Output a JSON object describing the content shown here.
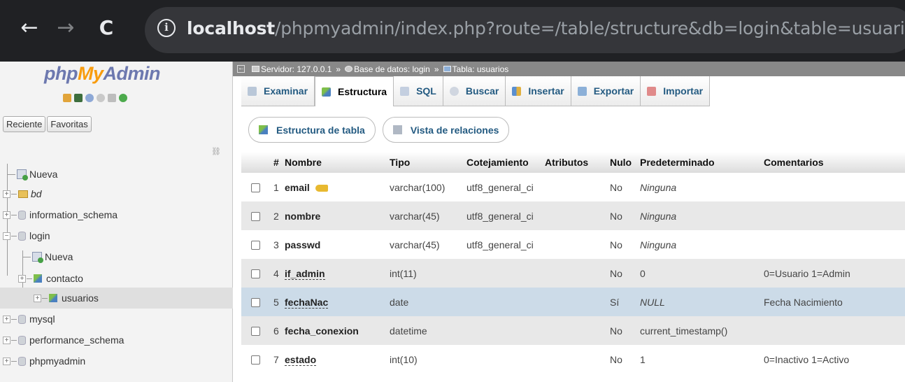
{
  "browser": {
    "url_host": "localhost",
    "url_path": "/phpmyadmin/index.php?route=/table/structure&db=login&table=usuarios"
  },
  "sidebar": {
    "logo": {
      "php": "php",
      "my": "My",
      "admin": "Admin"
    },
    "tabs": [
      "Reciente",
      "Favoritas"
    ],
    "tree": [
      {
        "label": "Nueva",
        "kind": "new"
      },
      {
        "label": "bd",
        "kind": "db-italic"
      },
      {
        "label": "information_schema",
        "kind": "db"
      },
      {
        "label": "login",
        "kind": "db-open"
      },
      {
        "label": "Nueva",
        "kind": "new-child"
      },
      {
        "label": "contacto",
        "kind": "table"
      },
      {
        "label": "usuarios",
        "kind": "table-selected"
      },
      {
        "label": "mysql",
        "kind": "db"
      },
      {
        "label": "performance_schema",
        "kind": "db"
      },
      {
        "label": "phpmyadmin",
        "kind": "db"
      }
    ]
  },
  "breadcrumb": {
    "server": "Servidor: 127.0.0.1",
    "database": "Base de datos: login",
    "table": "Tabla: usuarios",
    "separator": "»"
  },
  "tabs": [
    "Examinar",
    "Estructura",
    "SQL",
    "Buscar",
    "Insertar",
    "Exportar",
    "Importar"
  ],
  "active_tab": "Estructura",
  "subtabs": [
    "Estructura de tabla",
    "Vista de relaciones"
  ],
  "table": {
    "headers": [
      "#",
      "Nombre",
      "Tipo",
      "Cotejamiento",
      "Atributos",
      "Nulo",
      "Predeterminado",
      "Comentarios"
    ],
    "rows": [
      {
        "num": "1",
        "name": "email",
        "type": "varchar(100)",
        "collation": "utf8_general_ci",
        "attributes": "",
        "null": "No",
        "default": "Ninguna",
        "comment": ""
      },
      {
        "num": "2",
        "name": "nombre",
        "type": "varchar(45)",
        "collation": "utf8_general_ci",
        "attributes": "",
        "null": "No",
        "default": "Ninguna",
        "comment": ""
      },
      {
        "num": "3",
        "name": "passwd",
        "type": "varchar(45)",
        "collation": "utf8_general_ci",
        "attributes": "",
        "null": "No",
        "default": "Ninguna",
        "comment": ""
      },
      {
        "num": "4",
        "name": "if_admin",
        "type": "int(11)",
        "collation": "",
        "attributes": "",
        "null": "No",
        "default": "0",
        "comment": "0=Usuario 1=Admin"
      },
      {
        "num": "5",
        "name": "fechaNac",
        "type": "date",
        "collation": "",
        "attributes": "",
        "null": "Sí",
        "default": "NULL",
        "comment": "Fecha Nacimiento"
      },
      {
        "num": "6",
        "name": "fecha_conexion",
        "type": "datetime",
        "collation": "",
        "attributes": "",
        "null": "No",
        "default": "current_timestamp()",
        "comment": ""
      },
      {
        "num": "7",
        "name": "estado",
        "type": "int(10)",
        "collation": "",
        "attributes": "",
        "null": "No",
        "default": "1",
        "comment": "0=Inactivo 1=Activo"
      }
    ]
  },
  "colors": {
    "link": "#235a81",
    "highlight_row": "#ccdbe8",
    "logo_orange": "#f89c0e",
    "logo_blue": "#6c78af"
  }
}
